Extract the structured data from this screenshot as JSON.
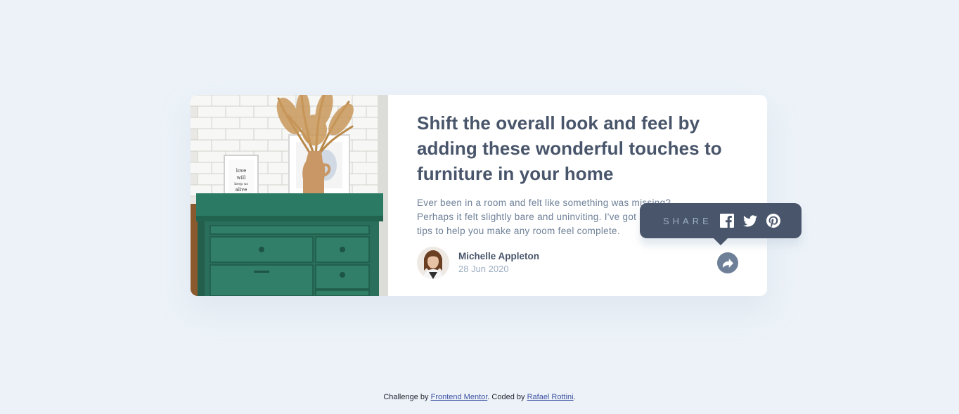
{
  "card": {
    "title": "Shift the overall look and feel by adding these wonderful touches to furniture in your home",
    "description": "Ever been in a room and felt like something was missing? Perhaps it felt slightly bare and uninviting. I've got some simple tips to help you make any room feel complete.",
    "image_alt": "drawers",
    "author": {
      "name": "Michelle Appleton",
      "date": "28 Jun 2020"
    }
  },
  "share": {
    "label": "SHARE",
    "icons": [
      "facebook-icon",
      "twitter-icon",
      "pinterest-icon"
    ],
    "button_icon": "share-arrow-icon"
  },
  "attribution": {
    "prefix": "Challenge by ",
    "link1": "Frontend Mentor",
    "middle": ". Coded by ",
    "link2": "Rafael Rottini",
    "suffix": "."
  },
  "colors": {
    "background": "#ECF2F8",
    "heading": "#48556A",
    "body": "#6E8098",
    "muted": "#9DAEC2",
    "popup": "#48556A"
  }
}
